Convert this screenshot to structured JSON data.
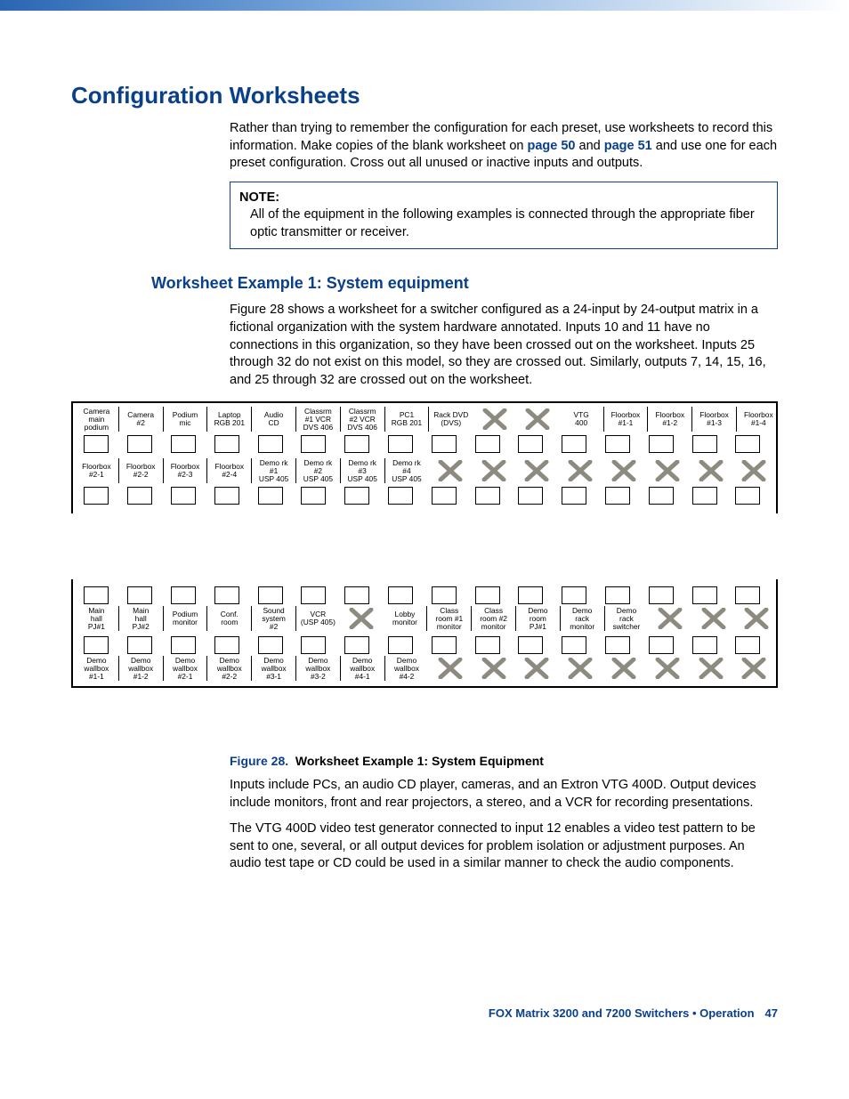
{
  "header": {
    "title": "Configuration Worksheets"
  },
  "intro": {
    "p1a": "Rather than trying to remember the configuration for each preset, use worksheets to record this information. Make copies of the blank worksheet on ",
    "link1": "page 50",
    "p1b": " and ",
    "link2": "page 51",
    "p1c": " and use one for each preset configuration. Cross out all unused or inactive inputs and outputs."
  },
  "note": {
    "label": "NOTE:",
    "text": "All of the equipment in the following examples is connected through the appropriate fiber optic transmitter or receiver."
  },
  "subsection": {
    "title": "Worksheet Example 1: System equipment",
    "p1": "Figure 28 shows a worksheet for a switcher configured as a 24-input by 24-output matrix in a fictional organization with the system hardware annotated. Inputs 10 and 11 have no connections in this organization, so they have been crossed out on the worksheet. Inputs 25 through 32 do not exist on this model, so they are crossed out. Similarly, outputs 7, 14, 15, 16, and 25 through 32 are crossed out on the worksheet."
  },
  "worksheet": {
    "inputs_row1": [
      {
        "label": "Camera\nmain\npodium"
      },
      {
        "label": "Camera\n#2"
      },
      {
        "label": "Podium\nmic"
      },
      {
        "label": "Laptop\nRGB 201"
      },
      {
        "label": "Audio\nCD"
      },
      {
        "label": "Classrm\n#1 VCR\nDVS 406"
      },
      {
        "label": "Classrm\n#2 VCR\nDVS 406"
      },
      {
        "label": "PC1\nRGB 201"
      },
      {
        "label": "Rack DVD\n(DVS)"
      },
      {
        "label": "",
        "crossed": true
      },
      {
        "label": "",
        "crossed": true
      },
      {
        "label": "VTG\n400"
      },
      {
        "label": "Floorbox\n#1-1"
      },
      {
        "label": "Floorbox\n#1-2"
      },
      {
        "label": "Floorbox\n#1-3"
      },
      {
        "label": "Floorbox\n#1-4"
      }
    ],
    "inputs_row2": [
      {
        "label": "Floorbox\n#2-1"
      },
      {
        "label": "Floorbox\n#2-2"
      },
      {
        "label": "Floorbox\n#2-3"
      },
      {
        "label": "Floorbox\n#2-4"
      },
      {
        "label": "Demo rk\n#1\nUSP 405"
      },
      {
        "label": "Demo rk\n#2\nUSP 405"
      },
      {
        "label": "Demo rk\n#3\nUSP 405"
      },
      {
        "label": "Demo rk\n#4\nUSP 405"
      },
      {
        "label": "",
        "crossed": true
      },
      {
        "label": "",
        "crossed": true
      },
      {
        "label": "",
        "crossed": true
      },
      {
        "label": "",
        "crossed": true
      },
      {
        "label": "",
        "crossed": true
      },
      {
        "label": "",
        "crossed": true
      },
      {
        "label": "",
        "crossed": true
      },
      {
        "label": "",
        "crossed": true
      }
    ],
    "outputs_row1": [
      {
        "label": "Main\nhall\nPJ#1"
      },
      {
        "label": "Main\nhall\nPJ#2"
      },
      {
        "label": "Podium\nmonitor"
      },
      {
        "label": "Conf.\nroom"
      },
      {
        "label": "Sound\nsystem\n#2"
      },
      {
        "label": "VCR\n(USP 405)"
      },
      {
        "label": "",
        "crossed": true
      },
      {
        "label": "Lobby\nmonitor"
      },
      {
        "label": "Class\nroom #1\nmonitor"
      },
      {
        "label": "Class\nroom #2\nmonitor"
      },
      {
        "label": "Demo\nroom\nPJ#1"
      },
      {
        "label": "Demo\nrack\nmonitor"
      },
      {
        "label": "Demo\nrack\nswitcher"
      },
      {
        "label": "",
        "crossed": true
      },
      {
        "label": "",
        "crossed": true
      },
      {
        "label": "",
        "crossed": true
      }
    ],
    "outputs_row2": [
      {
        "label": "Demo\nwallbox\n#1-1"
      },
      {
        "label": "Demo\nwallbox\n#1-2"
      },
      {
        "label": "Demo\nwallbox\n#2-1"
      },
      {
        "label": "Demo\nwallbox\n#2-2"
      },
      {
        "label": "Demo\nwallbox\n#3-1"
      },
      {
        "label": "Demo\nwallbox\n#3-2"
      },
      {
        "label": "Demo\nwallbox\n#4-1"
      },
      {
        "label": "Demo\nwallbox\n#4-2"
      },
      {
        "label": "",
        "crossed": true
      },
      {
        "label": "",
        "crossed": true
      },
      {
        "label": "",
        "crossed": true
      },
      {
        "label": "",
        "crossed": true
      },
      {
        "label": "",
        "crossed": true
      },
      {
        "label": "",
        "crossed": true
      },
      {
        "label": "",
        "crossed": true
      },
      {
        "label": "",
        "crossed": true
      }
    ]
  },
  "figure": {
    "num": "Figure 28.",
    "title": "Worksheet Example 1: System Equipment"
  },
  "after": {
    "p1": "Inputs include PCs, an audio CD player, cameras, and an Extron VTG 400D. Output devices include monitors, front and rear projectors, a stereo, and a VCR for recording presentations.",
    "p2": "The VTG 400D video test generator connected to input 12 enables a video test pattern to be sent to one, several, or all output devices for problem isolation or adjustment purposes. An audio test tape or CD could be used in a similar manner to check the audio components."
  },
  "footer": {
    "text": "FOX Matrix 3200 and 7200 Switchers • Operation",
    "page": "47"
  }
}
